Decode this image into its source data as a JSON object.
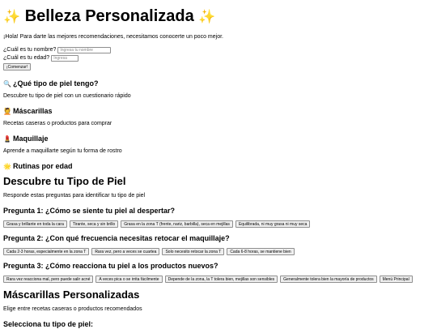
{
  "header": {
    "title": "Belleza Personalizada",
    "sparkle_left": "✨",
    "sparkle_right": "✨"
  },
  "intro": "¡Hola! Para darte las mejores recomendaciones, necesitamos conocerte un poco mejor.",
  "form": {
    "name_label": "¿Cuál es tu nombre?",
    "name_placeholder": "Ingresa tu nombre",
    "name_value": "",
    "age_label": "¿Cuál es tu edad?",
    "age_placeholder": "Ingresa",
    "age_value": "",
    "start_button": "¡Comenzar!"
  },
  "menu": [
    {
      "icon": "🔍",
      "icon_name": "magnifier-icon",
      "title": "¿Qué tipo de piel tengo?",
      "desc": "Descubre tu tipo de piel con un cuestionario rápido"
    },
    {
      "icon": "💆",
      "icon_name": "facial-massage-icon",
      "title": "Máscarillas",
      "desc": "Recetas caseras o productos para comprar"
    },
    {
      "icon": "💄",
      "icon_name": "lipstick-icon",
      "title": "Maquillaje",
      "desc": "Aprende a maquillarte según tu forma de rostro"
    },
    {
      "icon": "🌟",
      "icon_name": "star-icon",
      "title": "Rutinas por edad",
      "desc": ""
    }
  ],
  "quiz": {
    "title": "Descubre tu Tipo de Piel",
    "subtitle": "Responde estas preguntas para identificar tu tipo de piel",
    "questions": [
      {
        "title": "Pregunta 1: ¿Cómo se siente tu piel al despertar?",
        "options": [
          "Grasa y brillante en toda la cara",
          "Tirante, seca y sin brillo",
          "Grasa en la zona T (frente, nariz, barbilla), seca en mejillas",
          "Equilibrada, ni muy grasa ni muy seca"
        ]
      },
      {
        "title": "Pregunta 2: ¿Con qué frecuencia necesitas retocar el maquillaje?",
        "options": [
          "Cada 2-3 horas, especialmente en la zona T",
          "Rara vez, pero a veces se cuartea",
          "Solo necesito retocar la zona T",
          "Cada 6-8 horas, se mantiene bien"
        ]
      },
      {
        "title": "Pregunta 3: ¿Cómo reacciona tu piel a los productos nuevos?",
        "options": [
          "Rara vez reacciona mal, pero puede salir acné",
          "A veces pica o se irrita fácilmente",
          "Depende de la zona, la T tolera bien, mejillas son sensibles",
          "Generalmente tolera bien la mayoría de productos"
        ]
      }
    ],
    "main_menu_button": "Menú Principal"
  },
  "masks": {
    "title": "Máscarillas Personalizadas",
    "subtitle": "Elige entre recetas caseras o productos recomendados",
    "skin_type_label": "Selecciona tu tipo de piel:"
  }
}
